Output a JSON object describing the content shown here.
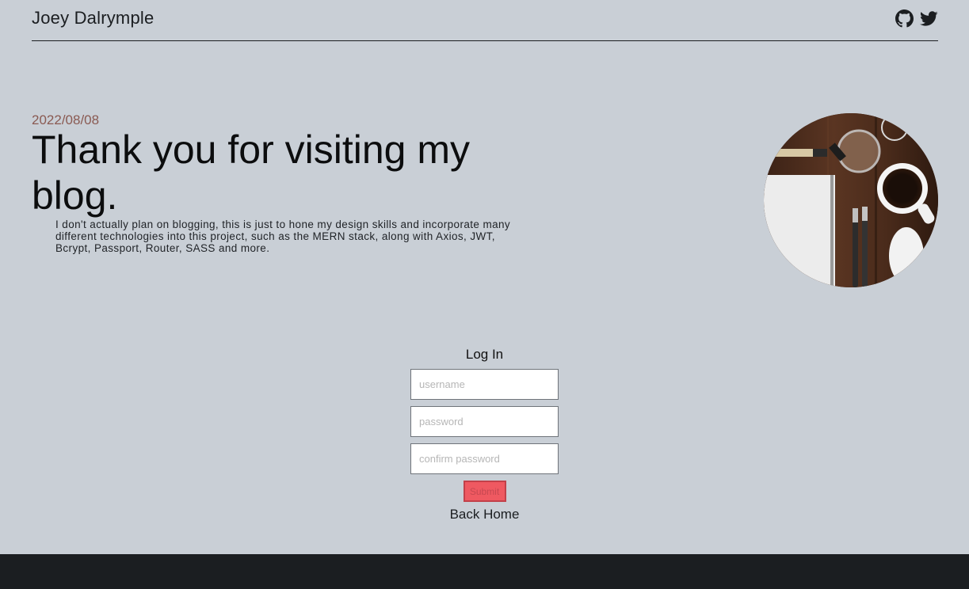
{
  "header": {
    "site_title": "Joey Dalrymple",
    "social": [
      {
        "icon": "github-icon"
      },
      {
        "icon": "twitter-icon"
      }
    ]
  },
  "hero": {
    "date": "2022/08/08",
    "title": "Thank you for visiting my blog.",
    "body": "I don't actually plan on blogging, this is just to hone my design skills and incorporate many different technologies into this project, such as the MERN stack, along with Axios, JWT, Bcrypt, Passport, Router, SASS and more."
  },
  "login": {
    "heading": "Log In",
    "username_placeholder": "username",
    "password_placeholder": "password",
    "confirm_placeholder": "confirm password",
    "submit_label": "Submit",
    "back_home_label": "Back Home"
  },
  "colors": {
    "background": "#c9cfd6",
    "footer": "#1b1e21",
    "date": "#8a5a52",
    "submit": "#ef5961"
  }
}
